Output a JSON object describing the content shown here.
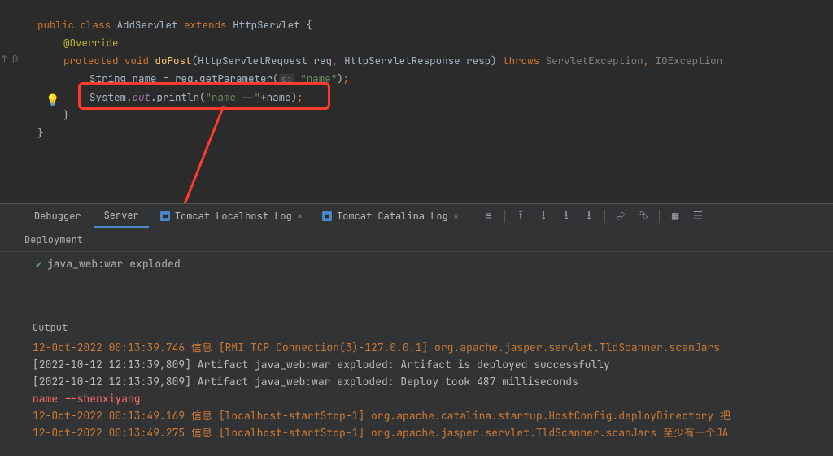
{
  "code": {
    "line1_public": "public ",
    "line1_class": "class ",
    "line1_name": "AddServlet ",
    "line1_extends": "extends ",
    "line1_super": "HttpServlet ",
    "line1_brace": "{",
    "line2_anno": "@Override",
    "line3_protected": "protected ",
    "line3_void": "void ",
    "line3_method": "doPost",
    "line3_sig_a": "(HttpServletRequest req",
    "line3_sig_b": " HttpServletResponse resp) ",
    "line3_throws": "throws ",
    "line3_ex": "ServletException",
    "line3_io": " IOException ",
    "line4_a": "String name = req.getParameter(",
    "line4_hint": "s:",
    "line4_str": " \"name\"",
    "line4_b": ")",
    "line4_semi": ";",
    "line5_sys": "System.",
    "line5_out": "out",
    "line5_println": ".println(",
    "line5_str": "\"name --\"",
    "line5_plus": "+name)",
    "line5_semi": ";",
    "line6": "}",
    "line7": "}"
  },
  "gutter": {
    "mark": "↑ @"
  },
  "panel": {
    "tabs": {
      "debugger": "Debugger",
      "server": "Server",
      "localhost_log": "Tomcat Localhost Log",
      "catalina_log": "Tomcat Catalina Log"
    },
    "deployment": "Deployment",
    "artifact": "java_web:war exploded",
    "output_label": "Output"
  },
  "console": {
    "l1_ts": "12-Oct-2022 00:13:39.746 ",
    "l1_info": "信息 ",
    "l1_rest": "[RMI TCP Connection(3)-127.0.0.1] org.apache.jasper.servlet.TldScanner.scanJars",
    "l2": "[2022-10-12 12:13:39,809] Artifact java_web:war exploded: Artifact is deployed successfully",
    "l3": "[2022-10-12 12:13:39,809] Artifact java_web:war exploded: Deploy took 487 milliseconds",
    "l4": "name --shenxiyang",
    "l5_ts": "12-Oct-2022 00:13:49.169 ",
    "l5_info": "信息 ",
    "l5_rest": "[localhost-startStop-1] org.apache.catalina.startup.HostConfig.deployDirectory 把",
    "l6_ts": "12-Oct-2022 00:13:49.275 ",
    "l6_info": "信息 ",
    "l6_rest": "[localhost-startStop-1] org.apache.jasper.servlet.TldScanner.scanJars 至少有一个JA"
  }
}
